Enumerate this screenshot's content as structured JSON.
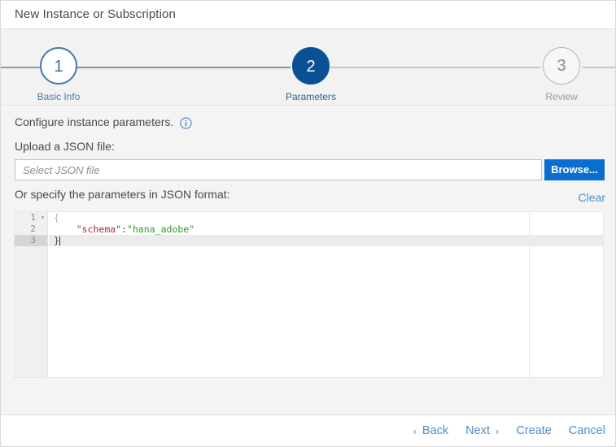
{
  "window": {
    "title": "New Instance or Subscription"
  },
  "wizard": {
    "steps": [
      {
        "number": "1",
        "label": "Basic Info",
        "state": "done"
      },
      {
        "number": "2",
        "label": "Parameters",
        "state": "active"
      },
      {
        "number": "3",
        "label": "Review",
        "state": "todo"
      }
    ]
  },
  "form": {
    "configure_text": "Configure instance parameters.",
    "info_icon": "info-icon",
    "upload_label": "Upload a JSON file:",
    "file_placeholder": "Select JSON file",
    "file_value": "",
    "browse_label": "Browse...",
    "or_specify_label": "Or specify the parameters in JSON format:",
    "clear_label": "Clear"
  },
  "editor": {
    "lines": [
      {
        "num": "1",
        "fold": "▾",
        "current": false,
        "tokens": [
          {
            "t": "{",
            "c": "tok-brace"
          }
        ]
      },
      {
        "num": "2",
        "fold": "",
        "current": false,
        "tokens": [
          {
            "t": "    ",
            "c": "tok-punc"
          },
          {
            "t": "\"schema\"",
            "c": "tok-key"
          },
          {
            "t": ":",
            "c": "tok-punc"
          },
          {
            "t": "\"hana_adobe\"",
            "c": "tok-str"
          }
        ]
      },
      {
        "num": "3",
        "fold": "",
        "current": true,
        "tokens": [
          {
            "t": "}",
            "c": "tok-punc"
          }
        ],
        "caret": true
      }
    ],
    "plain_text": "{\n    \"schema\":\"hana_adobe\"\n}"
  },
  "footer": {
    "back_label": "Back",
    "next_label": "Next",
    "create_label": "Create",
    "cancel_label": "Cancel",
    "back_chevron": "‹",
    "next_chevron": "›"
  },
  "colors": {
    "accent_blue": "#0a6ed1",
    "active_step": "#0a5193",
    "link_blue": "#4f8ecb",
    "json_key": "#b5292e",
    "json_string": "#2a9a2a"
  }
}
